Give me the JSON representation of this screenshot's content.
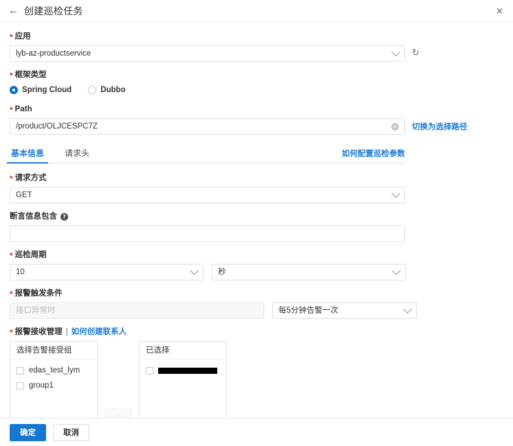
{
  "header": {
    "back_icon": "back-arrow-icon",
    "title": "创建巡检任务",
    "close_icon": "✕"
  },
  "form": {
    "application": {
      "label": "应用",
      "required": true,
      "value": "lyb-az-productservice",
      "refresh_icon": "↻"
    },
    "framework": {
      "label": "框架类型",
      "required": true,
      "options": [
        {
          "label": "Spring Cloud",
          "selected": true
        },
        {
          "label": "Dubbo",
          "selected": false
        }
      ]
    },
    "path": {
      "label": "Path",
      "required": true,
      "value": "/product/OLJCESPC7Z",
      "clear_icon": "✕",
      "switch_link": "切换为选择路径"
    },
    "tabs": {
      "items": [
        {
          "label": "基本信息",
          "active": true
        },
        {
          "label": "请求头",
          "active": false
        }
      ],
      "right_link": "如何配置巡检参数"
    },
    "method": {
      "label": "请求方式",
      "required": true,
      "value": "GET"
    },
    "assertion": {
      "label": "断言信息包含",
      "required": false,
      "help_icon": "?",
      "value": "",
      "placeholder": ""
    },
    "period": {
      "label": "巡检周期",
      "required": true,
      "value": "10",
      "unit": "秒"
    },
    "alert_condition": {
      "label": "报警触发条件",
      "required": true,
      "condition_value": "接口异常时",
      "condition_disabled": true,
      "frequency_value": "每5分钟告警一次"
    },
    "alert_receivers": {
      "label": "报警接收管理",
      "required": true,
      "separator": "|",
      "link": "如何创建联系人",
      "source_panel": {
        "title": "选择告警接受组",
        "items": [
          {
            "label": "edas_test_lym",
            "checked": false
          },
          {
            "label": "group1",
            "checked": false
          }
        ]
      },
      "transfer_button": "›",
      "target_panel": {
        "title": "已选择",
        "items": [
          {
            "label": "",
            "redacted": true,
            "checked": false
          }
        ]
      }
    }
  },
  "footer": {
    "confirm_label": "确定",
    "cancel_label": "取消"
  },
  "colors": {
    "primary": "#1577cf",
    "link": "#1f7bd5",
    "required_star": "#d93026",
    "radio_checked": "#0070cc",
    "border": "#dcdee3"
  }
}
